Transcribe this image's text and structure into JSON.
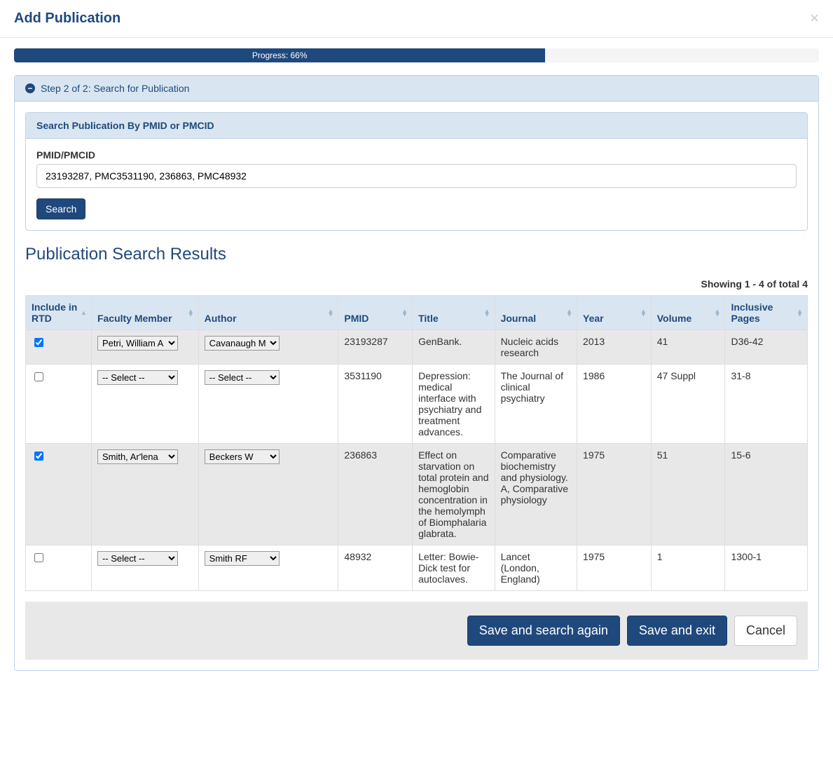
{
  "header": {
    "title": "Add Publication"
  },
  "progress": {
    "width": "66%",
    "label": "Progress: 66%"
  },
  "step": {
    "title": "Step 2 of 2: Search for Publication"
  },
  "searchSection": {
    "title": "Search Publication By PMID or PMCID",
    "fieldLabel": "PMID/PMCID",
    "fieldValue": "23193287, PMC3531190, 236863, PMC48932",
    "searchButton": "Search"
  },
  "results": {
    "title": "Publication Search Results",
    "summary": "Showing 1 - 4 of total 4",
    "columns": {
      "include": "Include in RTD",
      "faculty": "Faculty Member",
      "author": "Author",
      "pmid": "PMID",
      "title": "Title",
      "journal": "Journal",
      "year": "Year",
      "volume": "Volume",
      "pages": "Inclusive Pages"
    },
    "facultyOptions": [
      "-- Select --",
      "Petri, William A",
      "Smith, Ar'lena"
    ],
    "authorOptions": [
      "-- Select --",
      "Cavanaugh M",
      "Beckers W",
      "Smith RF"
    ],
    "rows": [
      {
        "checked": true,
        "highlighted": true,
        "faculty": "Petri, William A",
        "author": "Cavanaugh M",
        "pmid": "23193287",
        "title": "GenBank.",
        "journal": "Nucleic acids research",
        "year": "2013",
        "volume": "41",
        "pages": "D36-42"
      },
      {
        "checked": false,
        "highlighted": false,
        "faculty": "-- Select --",
        "author": "-- Select --",
        "pmid": "3531190",
        "title": "Depression: medical interface with psychiatry and treatment advances.",
        "journal": "The Journal of clinical psychiatry",
        "year": "1986",
        "volume": "47 Suppl",
        "pages": "31-8"
      },
      {
        "checked": true,
        "highlighted": true,
        "faculty": "Smith, Ar'lena",
        "author": "Beckers W",
        "pmid": "236863",
        "title": "Effect on starvation on total protein and hemoglobin concentration in the hemolymph of Biomphalaria glabrata.",
        "journal": "Comparative biochemistry and physiology. A, Comparative physiology",
        "year": "1975",
        "volume": "51",
        "pages": "15-6"
      },
      {
        "checked": false,
        "highlighted": false,
        "faculty": "-- Select --",
        "author": "Smith RF",
        "pmid": "48932",
        "title": "Letter: Bowie-Dick test for autoclaves.",
        "journal": "Lancet (London, England)",
        "year": "1975",
        "volume": "1",
        "pages": "1300-1"
      }
    ]
  },
  "actions": {
    "saveSearchAgain": "Save and search again",
    "saveExit": "Save and exit",
    "cancel": "Cancel"
  }
}
